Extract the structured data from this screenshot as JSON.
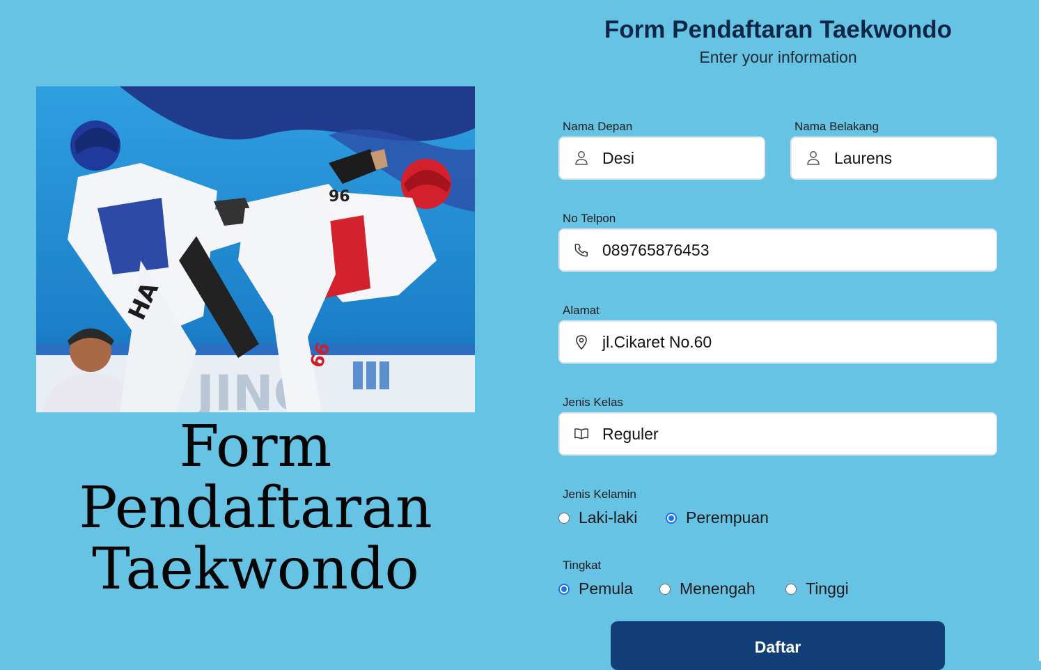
{
  "left": {
    "big_title_line1": "Form",
    "big_title_line2": "Pendaftaran",
    "big_title_line3": "Taekwondo"
  },
  "form": {
    "title": "Form Pendaftaran Taekwondo",
    "subtitle": "Enter your information",
    "nama_depan": {
      "label": "Nama Depan",
      "value": "Desi",
      "icon": "user-icon"
    },
    "nama_belakang": {
      "label": "Nama Belakang",
      "value": "Laurens",
      "icon": "user-icon"
    },
    "no_telpon": {
      "label": "No Telpon",
      "value": "089765876453",
      "icon": "phone-icon"
    },
    "alamat": {
      "label": "Alamat",
      "value": "jl.Cikaret No.60",
      "icon": "location-pin-icon"
    },
    "jenis_kelas": {
      "label": "Jenis Kelas",
      "value": "Reguler",
      "icon": "book-icon"
    },
    "jenis_kelamin": {
      "label": "Jenis Kelamin",
      "options": [
        "Laki-laki",
        "Perempuan"
      ],
      "selected": "Perempuan"
    },
    "tingkat": {
      "label": "Tingkat",
      "options": [
        "Pemula",
        "Menengah",
        "Tinggi"
      ],
      "selected": "Pemula"
    },
    "submit_label": "Daftar"
  },
  "colors": {
    "background": "#66c3e4",
    "title": "#0e2747",
    "button": "#123e77",
    "radio_checked": "#1a73e8"
  }
}
